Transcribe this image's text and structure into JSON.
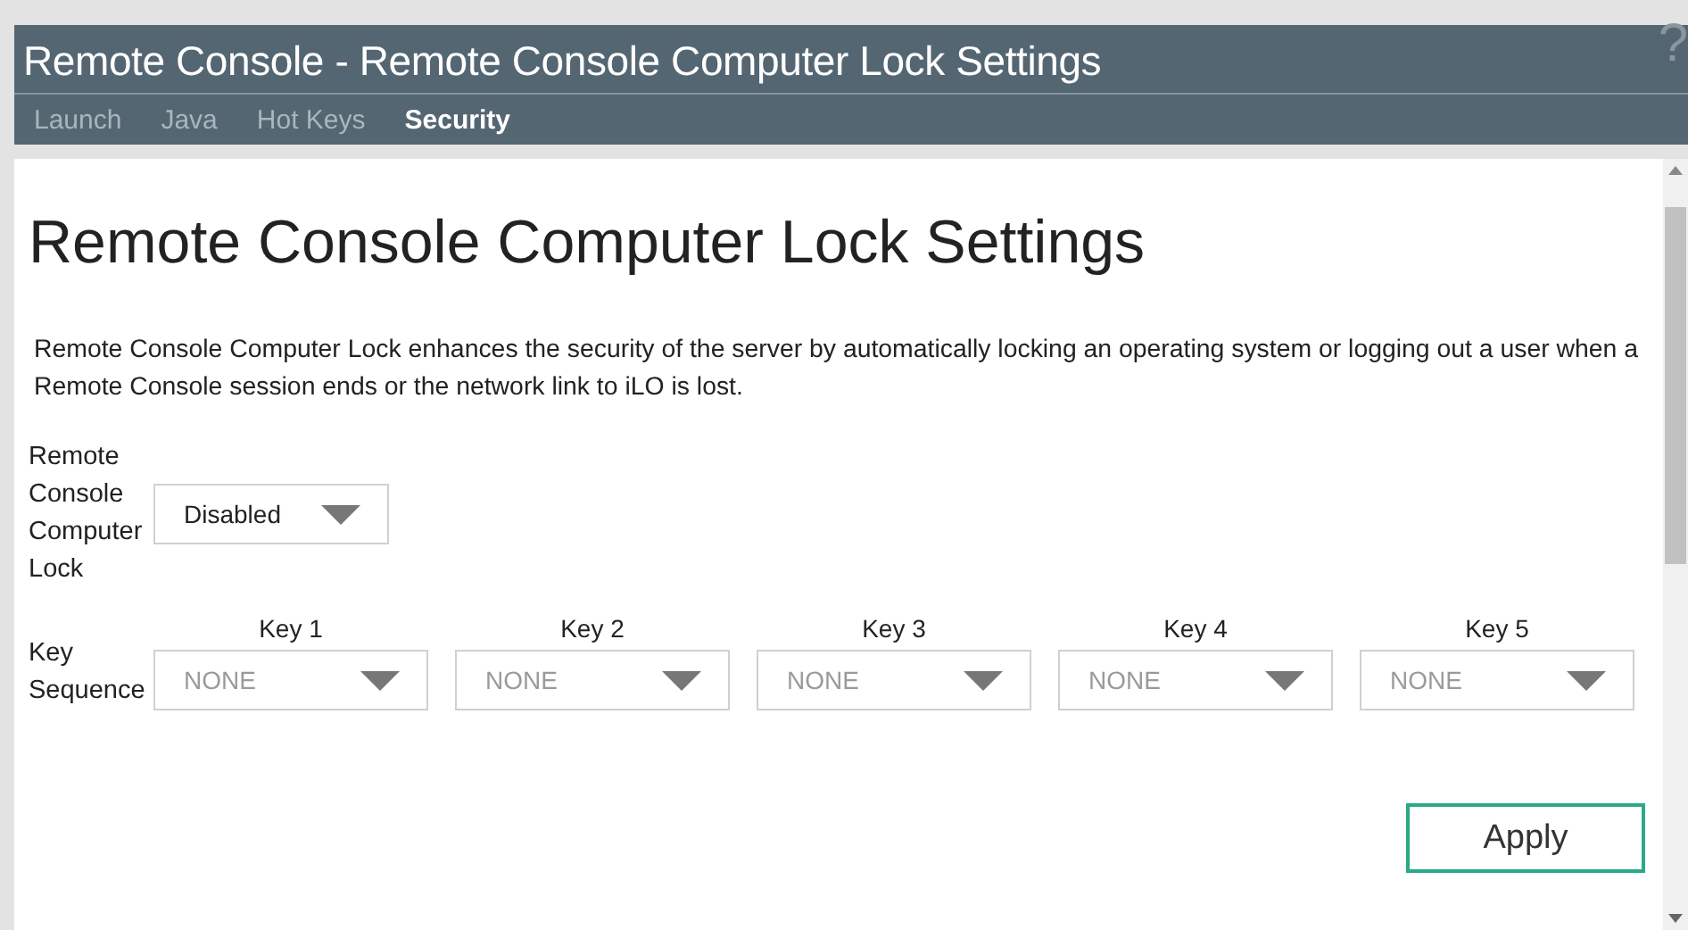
{
  "window": {
    "title": "Remote Console - Remote Console Computer Lock Settings",
    "help": "?"
  },
  "tabs": [
    {
      "label": "Launch",
      "selected": false
    },
    {
      "label": "Java",
      "selected": false
    },
    {
      "label": "Hot Keys",
      "selected": false
    },
    {
      "label": "Security",
      "selected": true
    }
  ],
  "page": {
    "heading": "Remote Console Computer Lock Settings",
    "description": "Remote Console Computer Lock enhances the security of the server by automatically locking an operating system or logging out a user when a Remote Console session ends or the network link to iLO is lost.",
    "lock": {
      "label": "Remote Console Computer Lock",
      "value": "Disabled",
      "disabled": false
    },
    "key_sequence": {
      "label": "Key Sequence",
      "keys": [
        {
          "label": "Key 1",
          "value": "NONE",
          "disabled": true
        },
        {
          "label": "Key 2",
          "value": "NONE",
          "disabled": true
        },
        {
          "label": "Key 3",
          "value": "NONE",
          "disabled": true
        },
        {
          "label": "Key 4",
          "value": "NONE",
          "disabled": true
        },
        {
          "label": "Key 5",
          "value": "NONE",
          "disabled": true
        }
      ]
    },
    "apply": "Apply"
  }
}
